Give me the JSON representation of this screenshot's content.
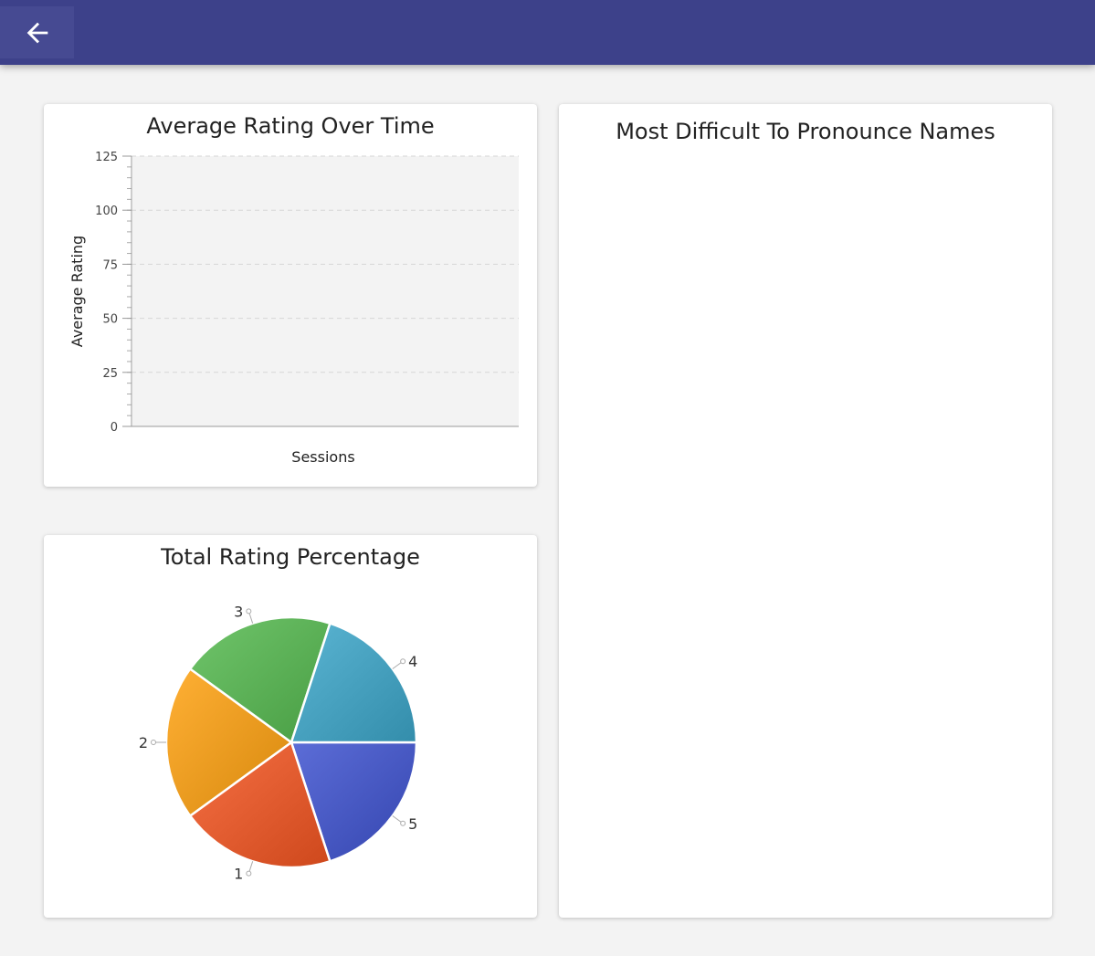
{
  "header": {
    "back_icon": "arrow-left-icon",
    "color": "#3d418a"
  },
  "line_chart_card": {
    "title": "Average Rating Over Time"
  },
  "pie_chart_card": {
    "title": "Total Rating Percentage"
  },
  "names_card": {
    "title": "Most Difficult To Pronounce Names"
  },
  "chart_data": [
    {
      "type": "line",
      "title": "Average Rating Over Time",
      "xlabel": "Sessions",
      "ylabel": "Average Rating",
      "ylim": [
        0,
        125
      ],
      "yticks": [
        "0",
        "25",
        "50",
        "75",
        "100",
        "125"
      ],
      "grid": true,
      "series": []
    },
    {
      "type": "pie",
      "title": "Total Rating Percentage",
      "categories": [
        "5",
        "1",
        "2",
        "3",
        "4"
      ],
      "values": [
        20,
        20,
        20,
        20,
        20
      ],
      "colors": [
        "#4657c1",
        "#e05a2e",
        "#e99a1f",
        "#5aaf55",
        "#459fbd"
      ]
    }
  ]
}
